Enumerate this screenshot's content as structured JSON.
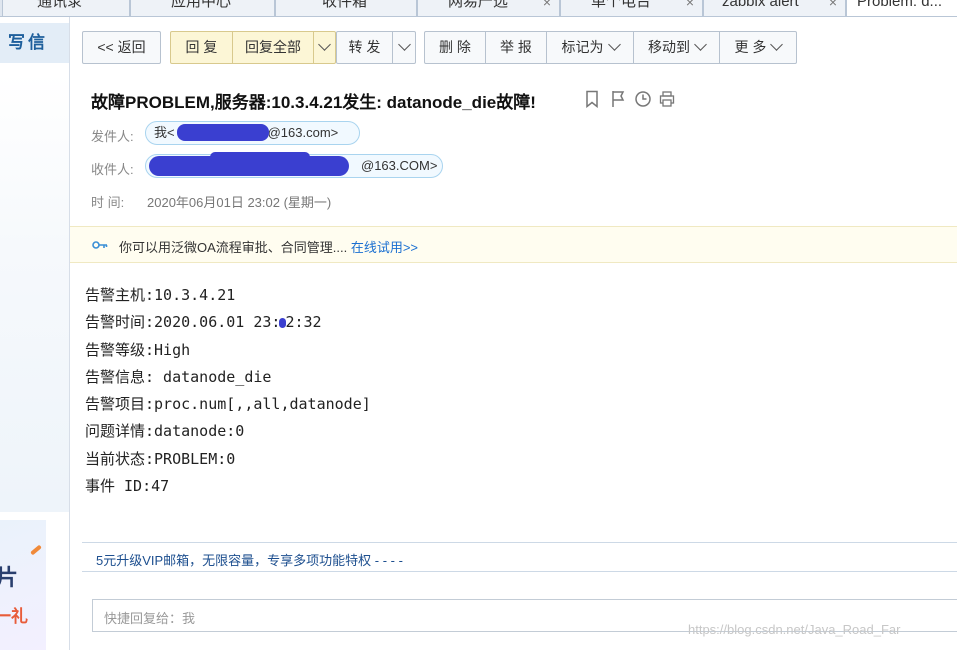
{
  "tabs": [
    {
      "label": "通讯录",
      "close": ""
    },
    {
      "label": "应用中心",
      "close": ""
    },
    {
      "label": "收件箱",
      "close": ""
    },
    {
      "label": "网易严选",
      "close": "×"
    },
    {
      "label": "单个电台",
      "close": "×"
    },
    {
      "label": "zabbix alert",
      "close": "×"
    },
    {
      "label": "Problem: d...",
      "close": ""
    }
  ],
  "sidebar": {
    "compose_label": "写信",
    "ad_line1": "片",
    "ad_line2": "一礼"
  },
  "toolbar": {
    "back": "<< 返回",
    "reply": "回 复",
    "reply_all": "回复全部",
    "forward": "转 发",
    "delete": "删 除",
    "report": "举 报",
    "mark_as": "标记为",
    "move_to": "移动到",
    "more": "更 多"
  },
  "header": {
    "subject": "故障PROBLEM,服务器:10.3.4.21发生: datanode_die故障!",
    "from_label": "发件人:",
    "from_prefix": "我<",
    "from_suffix": "@163.com>",
    "to_label": "收件人:",
    "to_suffix": "@163.COM>",
    "time_label": "时   间:",
    "time_value": "2020年06月01日 23:02 (星期一)"
  },
  "notice": {
    "text": "你可以用泛微OA流程审批、合同管理.... ",
    "link": "在线试用>>"
  },
  "body_lines": {
    "line1": "告警主机:10.3.4.21",
    "line2a": "告警时间:2020.06.01 23:",
    "line2b": "2:32",
    "line3": "告警等级:High",
    "line4": "告警信息: datanode_die",
    "line5": "告警项目:proc.num[,,all,datanode]",
    "line6": "问题详情:datanode:0",
    "line7": "当前状态:PROBLEM:0",
    "line8": "事件 ID:47"
  },
  "vip": {
    "text": "5元升级VIP邮箱，无限容量，专享多项功能特权 - - - -"
  },
  "quick_reply": {
    "placeholder": "快捷回复给：我"
  },
  "watermark": "https://blog.csdn.net/Java_Road_Far",
  "colors": {
    "link": "#1a6fd1",
    "yellow_button": "#fcf6d6",
    "redaction": "#3a3fd0"
  }
}
